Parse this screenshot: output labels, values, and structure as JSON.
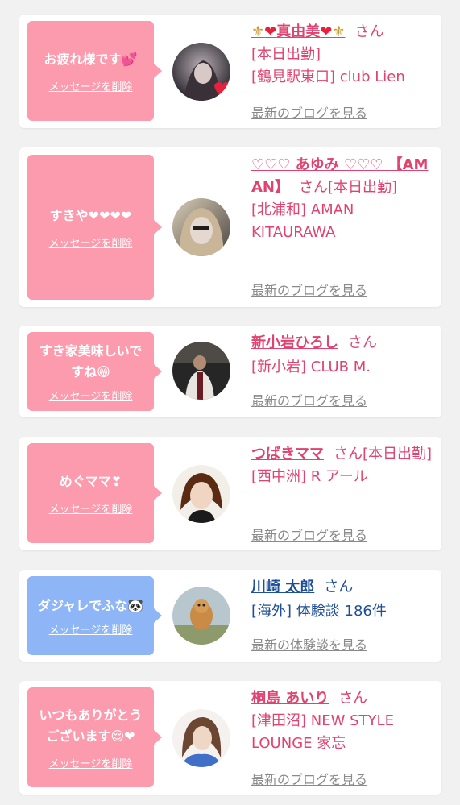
{
  "delete_label": "メッセージを削除",
  "honorific": "さん",
  "cards": [
    {
      "message": "お疲れ様です💕",
      "name_prefix": "⚜",
      "name_heart1": "❤",
      "name": "真由美",
      "name_heart2": "❤",
      "name_suffix": "⚜",
      "detail": "[本日出勤]\n[鶴見駅東口] club Lien",
      "link": "最新のブログを見る"
    },
    {
      "message": "すきや❤❤❤❤",
      "name": "♡♡♡ あゆみ ♡♡♡ 【AMAN】",
      "inline_after": "[本日出勤]",
      "detail": "[北浦和] AMAN KITAURAWA",
      "link": "最新のブログを見る"
    },
    {
      "message": "すき家美味しいで\nすね😁",
      "name": "新小岩ひろし",
      "detail": "[新小岩] CLUB M.",
      "link": "最新のブログを見る"
    },
    {
      "message": "めぐママ❣",
      "name": "つばきママ",
      "inline_after": "[本日出勤]",
      "detail": "[西中洲] R アール",
      "link": "最新のブログを見る"
    },
    {
      "message": "ダジャレでふな🐼",
      "name": "川崎 太郎",
      "detail": "[海外] 体験談 186件",
      "link": "最新の体験談を見る"
    },
    {
      "message": "いつもありがとう\nございます😌❤",
      "name": "桐島 あいり",
      "detail": "[津田沼] NEW STYLE LOUNGE 家忘",
      "link": "最新のブログを見る"
    }
  ],
  "colors": {
    "accent_pink": "#e0436f",
    "bubble_pink": "#fc9bad",
    "bubble_blue": "#8eb6f6",
    "name_blue": "#1f4f96",
    "link_gray": "#8a8a8a"
  }
}
